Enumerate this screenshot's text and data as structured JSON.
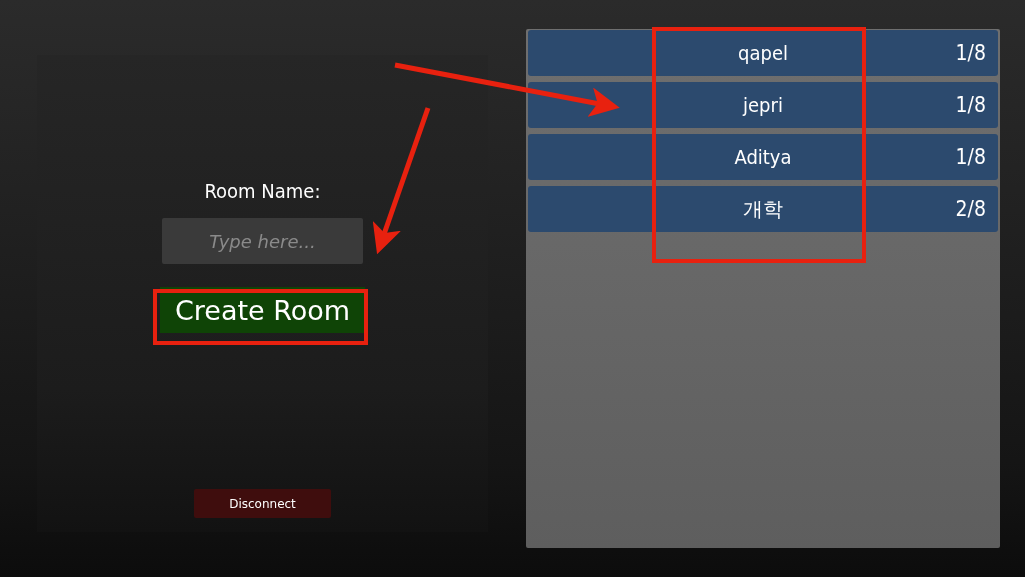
{
  "create_panel": {
    "label": "Room Name:",
    "room_name_field": {
      "placeholder": "Type here..."
    },
    "create_button": "Create Room",
    "disconnect_button": "Disconnect"
  },
  "room_list": [
    {
      "name": "qapel",
      "players": "1/8"
    },
    {
      "name": "jepri",
      "players": "1/8"
    },
    {
      "name": "Aditya",
      "players": "1/8"
    },
    {
      "name": "개학",
      "players": "2/8"
    }
  ]
}
